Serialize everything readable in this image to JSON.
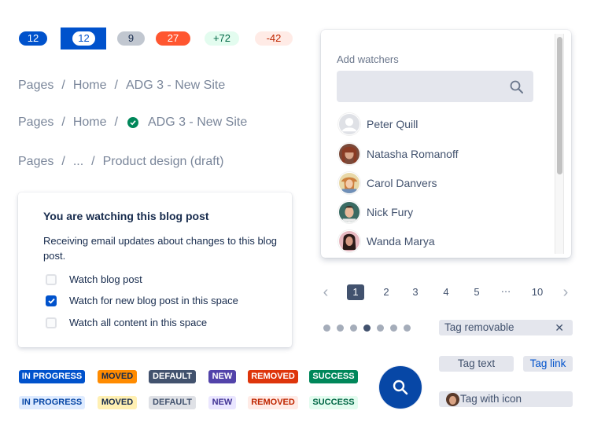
{
  "badges": [
    {
      "value": "12",
      "style": "primary"
    },
    {
      "value": "12",
      "style": "primary-inverted"
    },
    {
      "value": "9",
      "style": "default"
    },
    {
      "value": "27",
      "style": "important"
    },
    {
      "value": "+72",
      "style": "added"
    },
    {
      "value": "-42",
      "style": "removed"
    }
  ],
  "breadcrumbs": [
    {
      "items": [
        "Pages",
        "Home",
        "ADG 3 - New Site"
      ],
      "icon": null
    },
    {
      "items": [
        "Pages",
        "Home",
        "ADG 3 - New Site"
      ],
      "icon": "check-circle-icon"
    },
    {
      "items": [
        "Pages",
        "...",
        "Product design (draft)"
      ],
      "icon": null
    }
  ],
  "separator": "/",
  "watch_card": {
    "title": "You are watching this blog post",
    "description": "Receiving email updates about changes to this blog post.",
    "options": [
      {
        "label": "Watch blog post",
        "checked": false
      },
      {
        "label": "Watch for new blog post in this space",
        "checked": true
      },
      {
        "label": "Watch all content in this space",
        "checked": false
      }
    ]
  },
  "lozenges": {
    "bold": [
      {
        "label": "IN PROGRESS",
        "bg": "#0052cc",
        "fg": "#ffffff"
      },
      {
        "label": "MOVED",
        "bg": "#ff8b00",
        "fg": "#172b4d"
      },
      {
        "label": "DEFAULT",
        "bg": "#42526e",
        "fg": "#ffffff"
      },
      {
        "label": "NEW",
        "bg": "#5243aa",
        "fg": "#ffffff"
      },
      {
        "label": "REMOVED",
        "bg": "#de350b",
        "fg": "#ffffff"
      },
      {
        "label": "SUCCESS",
        "bg": "#00875a",
        "fg": "#ffffff"
      }
    ],
    "subtle": [
      {
        "label": "IN PROGRESS",
        "bg": "#deebff",
        "fg": "#0747a6"
      },
      {
        "label": "MOVED",
        "bg": "#fff0b3",
        "fg": "#172b4d"
      },
      {
        "label": "DEFAULT",
        "bg": "#dfe1e6",
        "fg": "#42526e"
      },
      {
        "label": "NEW",
        "bg": "#eae6ff",
        "fg": "#403294"
      },
      {
        "label": "REMOVED",
        "bg": "#ffebe6",
        "fg": "#bf2600"
      },
      {
        "label": "SUCCESS",
        "bg": "#e3fcef",
        "fg": "#006644"
      }
    ]
  },
  "watchers": {
    "label": "Add watchers",
    "search_value": "",
    "users": [
      {
        "name": "Peter Quill",
        "avatar": "default-avatar"
      },
      {
        "name": "Natasha Romanoff",
        "avatar": "photo"
      },
      {
        "name": "Carol Danvers",
        "avatar": "photo"
      },
      {
        "name": "Nick Fury",
        "avatar": "photo"
      },
      {
        "name": "Wanda Marya",
        "avatar": "photo"
      }
    ]
  },
  "pagination": {
    "prev": "‹",
    "next": "›",
    "pages": [
      "1",
      "2",
      "3",
      "4",
      "5",
      "…",
      "10"
    ],
    "current": "1"
  },
  "progress_dots": {
    "count": 7,
    "active_index": 3
  },
  "tags": {
    "removable": "Tag removable",
    "remove_glyph": "✕",
    "text": "Tag text",
    "link": "Tag link",
    "with_icon": "Tag with icon"
  },
  "colors": {
    "primary": "#0052cc",
    "fab": "#0747a6",
    "success": "#00875a",
    "link": "#0052cc"
  }
}
